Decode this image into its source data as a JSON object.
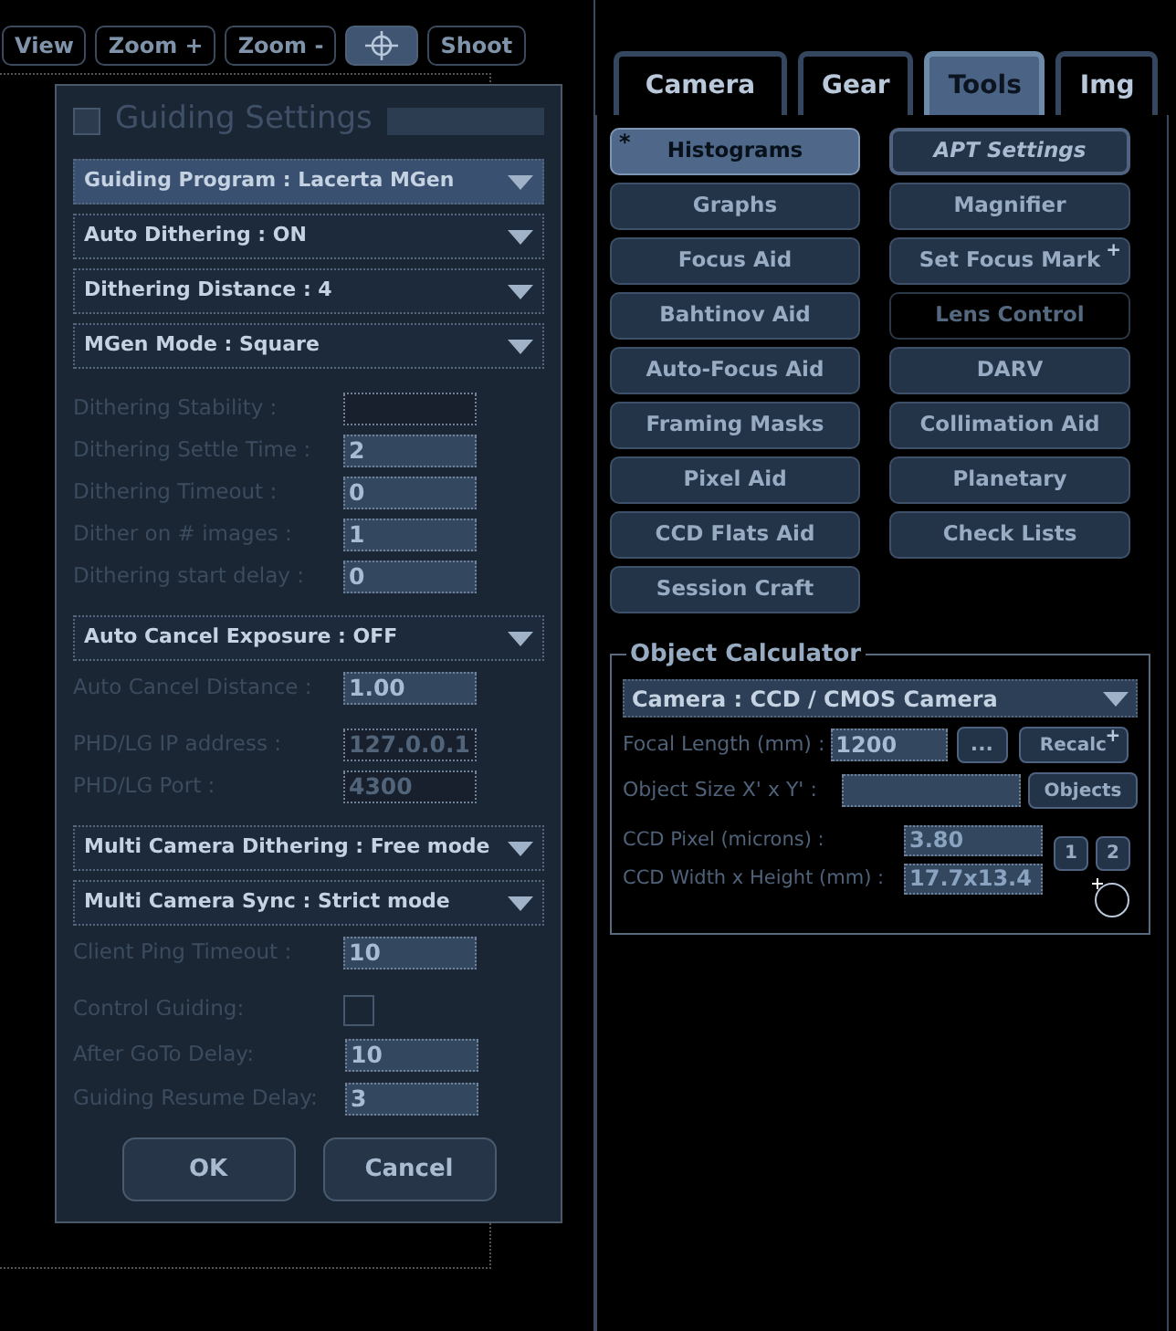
{
  "toolbar": [
    {
      "kind": "text",
      "label": "View",
      "selected": false
    },
    {
      "kind": "text",
      "label": "Zoom +",
      "selected": false
    },
    {
      "kind": "text",
      "label": "Zoom -",
      "selected": false
    },
    {
      "kind": "icon",
      "selected": true
    },
    {
      "kind": "text",
      "label": "Shoot",
      "selected": false
    }
  ],
  "dialog": {
    "title": "Guiding Settings",
    "checked": false,
    "groups": [
      [
        {
          "kind": "dropdown",
          "label": "Guiding Program : Lacerta MGen",
          "selected": true
        },
        {
          "kind": "dropdown",
          "label": "Auto Dithering : ON",
          "selected": false
        },
        {
          "kind": "dropdown",
          "label": "Dithering Distance : 4",
          "selected": false
        },
        {
          "kind": "dropdown",
          "label": "MGen Mode : Square",
          "selected": false
        }
      ],
      [
        {
          "kind": "field",
          "label": "Dithering Stability :",
          "disabled": true
        },
        {
          "kind": "field",
          "label": "Dithering Settle Time :",
          "value": "2",
          "disabled": false
        },
        {
          "kind": "field",
          "label": "Dithering Timeout :",
          "value": "0",
          "disabled": false
        },
        {
          "kind": "field",
          "label": "Dither on # images :",
          "value": "1",
          "disabled": false
        },
        {
          "kind": "field",
          "label": "Dithering start delay :",
          "value": "0",
          "disabled": false
        }
      ],
      [
        {
          "kind": "dropdown",
          "label": "Auto Cancel Exposure : OFF",
          "selected": false
        },
        {
          "kind": "field",
          "label": "Auto Cancel Distance :",
          "value": "1.00",
          "disabled": false
        }
      ],
      [
        {
          "kind": "field",
          "label": "PHD/LG IP address :",
          "value": "127.0.0.1",
          "disabled": true
        },
        {
          "kind": "field",
          "label": "PHD/LG Port :",
          "value": "4300",
          "disabled": true
        }
      ],
      [
        {
          "kind": "dropdown",
          "label": "Multi Camera Dithering : Free mode",
          "selected": false
        },
        {
          "kind": "dropdown",
          "label": "Multi Camera Sync : Strict mode",
          "selected": false
        },
        {
          "kind": "field",
          "label": "Client Ping Timeout :",
          "value": "10",
          "disabled": false
        }
      ],
      [
        {
          "kind": "checkbox",
          "label": "Control Guiding:",
          "checked": false
        },
        {
          "kind": "field",
          "label": "After GoTo Delay:",
          "value": "10",
          "disabled": false
        },
        {
          "kind": "field",
          "label": "Guiding Resume Delay:",
          "value": "3",
          "disabled": false
        }
      ]
    ],
    "buttons": [
      "OK",
      "Cancel"
    ]
  },
  "tabs": [
    {
      "label": "Camera",
      "selected": false
    },
    {
      "label": "Gear",
      "selected": false
    },
    {
      "label": "Tools",
      "selected": true
    },
    {
      "label": "Img",
      "selected": false
    }
  ],
  "tool_columns": [
    [
      {
        "label": "Histograms",
        "selected": true,
        "disabled": false,
        "italic": false,
        "badge": "*"
      },
      {
        "label": "Graphs",
        "selected": false,
        "disabled": false,
        "italic": false
      },
      {
        "label": "Focus Aid",
        "selected": false,
        "disabled": false,
        "italic": false
      },
      {
        "label": "Bahtinov Aid",
        "selected": false,
        "disabled": false,
        "italic": false
      },
      {
        "label": "Auto-Focus Aid",
        "selected": false,
        "disabled": false,
        "italic": false
      },
      {
        "label": "Framing Masks",
        "selected": false,
        "disabled": false,
        "italic": false
      },
      {
        "label": "Pixel Aid",
        "selected": false,
        "disabled": false,
        "italic": false
      },
      {
        "label": "CCD Flats Aid",
        "selected": false,
        "disabled": false,
        "italic": false
      },
      {
        "label": "Session Craft",
        "selected": false,
        "disabled": false,
        "italic": false
      }
    ],
    [
      {
        "label": "APT Settings",
        "selected": false,
        "disabled": false,
        "italic": true
      },
      {
        "label": "Magnifier",
        "selected": false,
        "disabled": false,
        "italic": false
      },
      {
        "label": "Set Focus Mark",
        "selected": false,
        "disabled": false,
        "italic": false,
        "badge": "+"
      },
      {
        "label": "Lens Control",
        "selected": false,
        "disabled": true,
        "italic": false
      },
      {
        "label": "DARV",
        "selected": false,
        "disabled": false,
        "italic": false
      },
      {
        "label": "Collimation Aid",
        "selected": false,
        "disabled": false,
        "italic": false
      },
      {
        "label": "Planetary",
        "selected": false,
        "disabled": false,
        "italic": false
      },
      {
        "label": "Check Lists",
        "selected": false,
        "disabled": false,
        "italic": false
      }
    ]
  ],
  "object_calculator": {
    "title": "Object Calculator",
    "camera": "Camera : CCD / CMOS Camera",
    "focal_length": {
      "label": "Focal Length (mm) :",
      "value": "1200",
      "more": "...",
      "recalc": "Recalc",
      "recalc_badge": "+"
    },
    "object_size": {
      "label": "Object Size X' x Y' :",
      "button": "Objects"
    },
    "ccd_pixel": {
      "label": "CCD Pixel (microns) :",
      "value": "3.80"
    },
    "ccd_size": {
      "label": "CCD Width x Height (mm) :",
      "value": "17.7x13.4"
    },
    "presets": [
      "1",
      "2"
    ]
  }
}
